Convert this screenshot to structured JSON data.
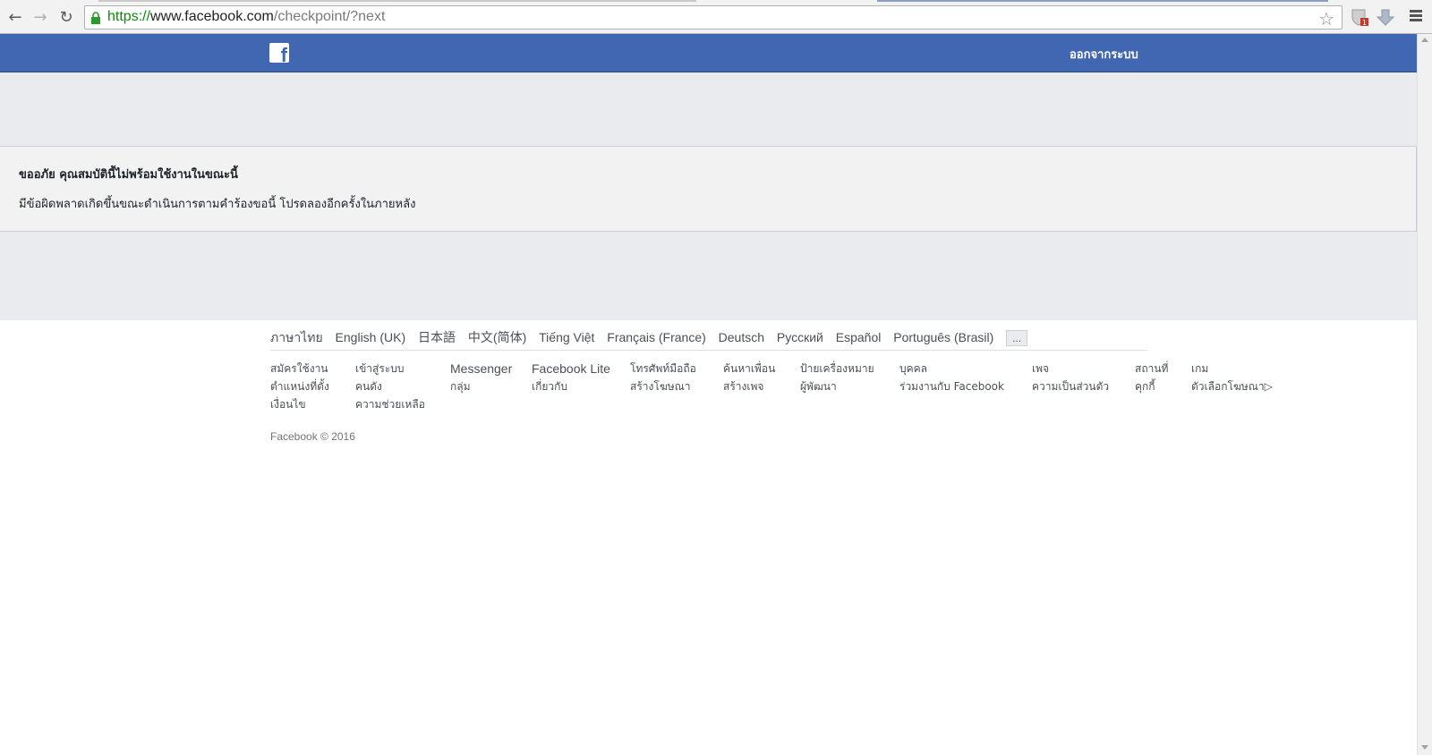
{
  "browser": {
    "url_scheme": "https://",
    "url_host": "www.facebook.com",
    "url_path": "/checkpoint/?next",
    "badge_count": "1"
  },
  "header": {
    "logo_letter": "f",
    "logout_label": "ออกจากระบบ"
  },
  "error": {
    "title": "ขออภัย คุณสมบัตินี้ไม่พร้อมใช้งานในขณะนี้",
    "message": "มีข้อผิดพลาดเกิดขึ้นขณะดำเนินการตามคำร้องขอนี้ โปรดลองอีกครั้งในภายหลัง"
  },
  "footer": {
    "languages": [
      "ภาษาไทย",
      "English (UK)",
      "日本語",
      "中文(简体)",
      "Tiếng Việt",
      "Français (France)",
      "Deutsch",
      "Русский",
      "Español",
      "Português (Brasil)"
    ],
    "more_label": "...",
    "columns": [
      [
        "สมัครใช้งาน",
        "ตำแหน่งที่ตั้ง",
        "เงื่อนไข"
      ],
      [
        "เข้าสู่ระบบ",
        "คนดัง",
        "ความช่วยเหลือ"
      ],
      [
        "Messenger",
        "กลุ่ม"
      ],
      [
        "Facebook Lite",
        "เกี่ยวกับ"
      ],
      [
        "โทรศัพท์มือถือ",
        "สร้างโฆษณา"
      ],
      [
        "ค้นหาเพื่อน",
        "สร้างเพจ"
      ],
      [
        "ป้ายเครื่องหมาย",
        "ผู้พัฒนา"
      ],
      [
        "บุคคล",
        "ร่วมงานกับ Facebook"
      ],
      [
        "เพจ",
        "ความเป็นส่วนตัว"
      ],
      [
        "สถานที่",
        "คุกกี้"
      ],
      [
        "เกม",
        "ตัวเลือกโฆษณา"
      ]
    ],
    "copyright": "Facebook © 2016"
  },
  "colors": {
    "fb_blue": "#4267b2",
    "page_bg": "#e9ebee",
    "link_gray": "#4b4f56"
  }
}
